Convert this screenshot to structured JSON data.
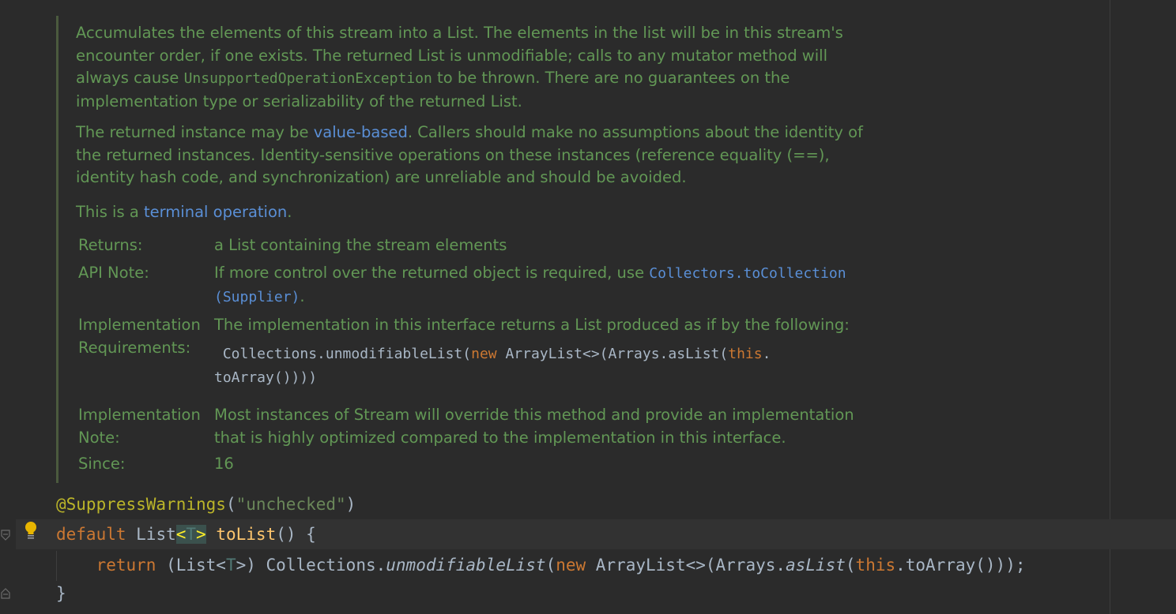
{
  "javadoc": {
    "para1_a": "Accumulates the elements of this stream into a List. The elements in the list will be in this stream's",
    "para1_b": "encounter order, if one exists. The returned List is unmodifiable; calls to any mutator method will",
    "para1_c1": "always cause ",
    "para1_c_code": "UnsupportedOperationException",
    "para1_c2": " to be thrown. There are no guarantees on the",
    "para1_d": "implementation type or serializability of the returned List.",
    "para2_a1": "The returned instance may be ",
    "para2_a_link": "value-based",
    "para2_a2": ". Callers should make no assumptions about the identity of",
    "para2_b": "the returned instances. Identity-sensitive operations on these instances (reference equality (==),",
    "para2_c": "identity hash code, and synchronization) are unreliable and should be avoided.",
    "para3_a": "This is a ",
    "para3_link": "terminal operation",
    "para3_b": ".",
    "returns_label": "Returns:",
    "returns_value": "a List containing the stream elements",
    "api_note_label": "API Note:",
    "api_note_value": "If more control over the returned object is required, use ",
    "api_note_link_1": "Collectors.toCollection",
    "api_note_link_2": "(Supplier)",
    "api_note_end": ".",
    "impl_req_label_1": "Implementation",
    "impl_req_label_2": "Requirements:",
    "impl_req_value": "The implementation in this interface returns a List produced as if by the following:",
    "impl_req_code_1a": " Collections.unmodifiableList(",
    "impl_req_code_kw_new": "new",
    "impl_req_code_1b": " ArrayList<>(Arrays.asList(",
    "impl_req_code_kw_this": "this",
    "impl_req_code_1c": ".",
    "impl_req_code_2": "toArray()))",
    "impl_req_code_2b": ")",
    "impl_note_label_1": "Implementation",
    "impl_note_label_2": "Note:",
    "impl_note_value_1": "Most instances of Stream will override this method and provide an implementation",
    "impl_note_value_2": "that is highly optimized compared to the implementation in this interface.",
    "since_label": "Since:",
    "since_value": "16"
  },
  "code": {
    "annotation": "@SuppressWarnings",
    "annotation_open": "(",
    "annotation_arg": "\"unchecked\"",
    "annotation_close": ")",
    "kw_default": "default",
    "type_list": " List",
    "lt": "<",
    "tp": "T",
    "gt": ">",
    "method_name": "toList",
    "sig_rest": "() {",
    "indent": "    ",
    "kw_return": "return",
    "body_1": " (List<",
    "body_tp": "T",
    "body_2": ">) Collections.",
    "body_method": "unmodifiableList",
    "body_3": "(",
    "body_kw_new": "new",
    "body_4": " ArrayList<>(Arrays.",
    "body_aslist": "asList",
    "body_5": "(",
    "body_kw_this": "this",
    "body_6": ".toArray()));",
    "close_brace": "}"
  }
}
